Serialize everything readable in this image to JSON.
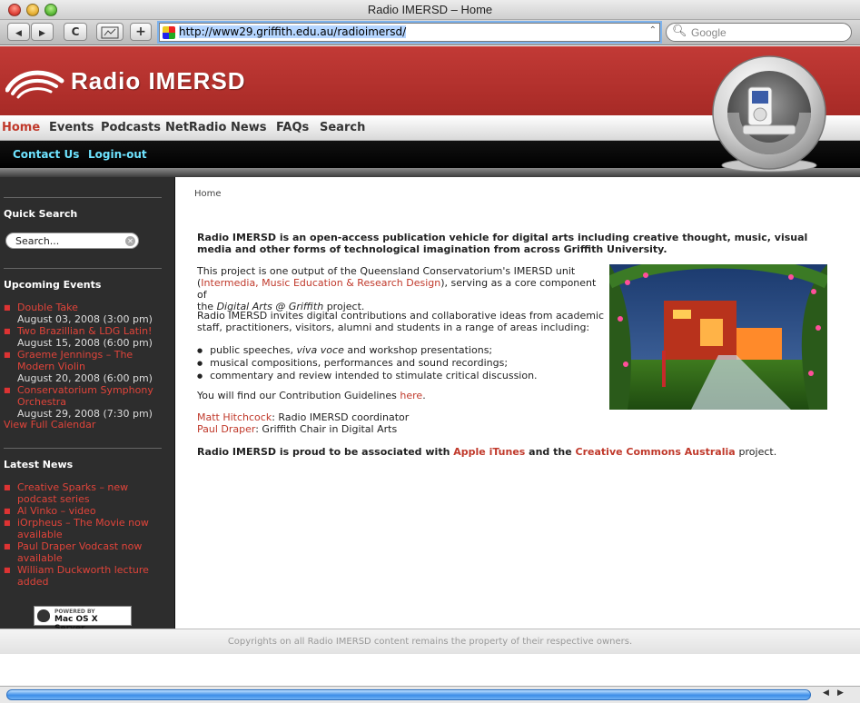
{
  "window": {
    "title": "Radio IMERSD – Home"
  },
  "toolbar": {
    "back": "◀",
    "forward": "▶",
    "reload": "C",
    "add": "+",
    "url": "http://www29.griffith.edu.au/radioimersd/",
    "search_placeholder": "Google"
  },
  "site": {
    "logo_text": "Radio IMERSD"
  },
  "nav": {
    "items": [
      "Home",
      "Events",
      "Podcasts",
      "NetRadio",
      "News",
      "FAQs",
      "Search"
    ],
    "sub": [
      "Contact Us",
      "Login-out"
    ]
  },
  "sidebar": {
    "quick_search_title": "Quick Search",
    "search_placeholder": "Search...",
    "events_title": "Upcoming Events",
    "events": [
      {
        "title": "Double Take",
        "date": "August 03, 2008 (3:00 pm)"
      },
      {
        "title": "Two Brazillian & LDG Latin!",
        "date": "August 15, 2008 (6:00 pm)"
      },
      {
        "title": "Graeme Jennings – The",
        "title2": "Modern Violin",
        "date": "August 20, 2008 (6:00 pm)"
      },
      {
        "title": "Conservatorium Symphony",
        "title2": "Orchestra",
        "date": "August 29, 2008 (7:30 pm)"
      }
    ],
    "full_calendar": "View Full Calendar",
    "news_title": "Latest News",
    "news": [
      {
        "l1": "Creative Sparks – new",
        "l2": "podcast series"
      },
      {
        "l1": "Al Vinko – video",
        "l2": ""
      },
      {
        "l1": "iOrpheus – The Movie now",
        "l2": "available"
      },
      {
        "l1": "Paul Draper Vodcast now",
        "l2": "available"
      },
      {
        "l1": "William Duckworth lecture",
        "l2": "added"
      }
    ],
    "badge_top": "POWERED BY",
    "badge_bottom": "Mac OS X Server"
  },
  "main": {
    "breadcrumb": "Home",
    "intro_bold": "Radio IMERSD is an open-access publication vehicle for digital arts including creative thought, music, visual media and other forms of technological imagination from across Griffith University.",
    "p2_a": "This project is one output of the Queensland Conservatorium's IMERSD unit",
    "p2_open": "(",
    "p2_link": "Intermedia, Music Education & Research Design",
    "p2_b": "), serving as a core component of",
    "p2_c": "the",
    "p2_italic": "Digital Arts @ Griffith",
    "p2_d": "project.",
    "p3_a": "Radio IMERSD invites digital contributions and collaborative ideas from academic",
    "p3_b": "staff, practitioners, visitors, alumni and students in a range of areas including:",
    "list": [
      {
        "a": "public speeches, ",
        "i": "viva voce",
        "b": " and workshop presentations;"
      },
      {
        "a": "musical compositions, performances and sound recordings;",
        "i": "",
        "b": ""
      },
      {
        "a": "commentary and review intended to stimulate critical discussion.",
        "i": "",
        "b": ""
      }
    ],
    "guidelines_text": "You will find our Contribution Guidelines",
    "guidelines_link": "here",
    "guidelines_end": ".",
    "people": [
      {
        "name": "Matt Hitchcock",
        "role": ": Radio IMERSD coordinator"
      },
      {
        "name": "Paul Draper",
        "role": ": Griffith Chair in Digital Arts"
      }
    ],
    "assoc_a": "Radio IMERSD is proud to be associated with",
    "assoc_link1": "Apple iTunes",
    "assoc_b": "and the",
    "assoc_link2": "Creative Commons Australia",
    "assoc_c": "project."
  },
  "footer": {
    "text": "Copyrights on all Radio IMERSD content remains the property of their respective owners."
  }
}
